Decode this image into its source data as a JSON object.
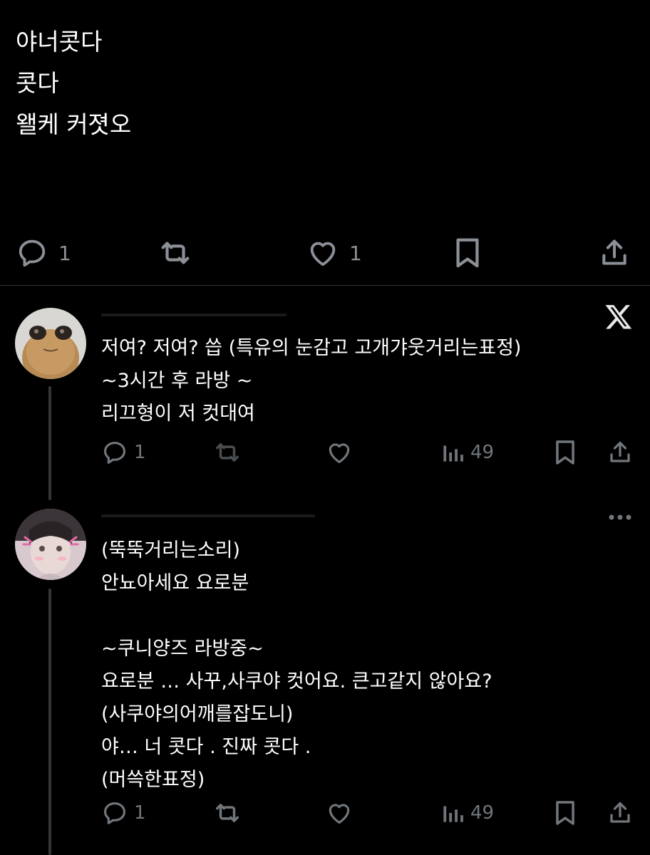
{
  "top_tweet": {
    "lines": [
      "야너콧다",
      "콧다",
      "왤케 커졋오"
    ],
    "reply_count": "1",
    "like_count": "1"
  },
  "replies": [
    {
      "lines": [
        "저여? 저여?  씁 (특유의 눈감고 고개갸웃거리는표정)",
        "~3시간 후 라방 ~",
        "리끄형이  저 컷대여"
      ],
      "reply_count": "1",
      "views_count": "49"
    },
    {
      "lines": [
        "(뚝뚝거리는소리)",
        "안뇨아세요  요로분",
        "",
        "~쿠니양즈  라방중~",
        "요로분 … 사꾸,사쿠야 컷어요. 큰고같지 않아요?",
        "(사쿠야의어깨를잡도니)",
        "야… 너 콧다 .  진짜 콧다  .",
        "(머쓱한표정)"
      ],
      "reply_count": "1",
      "views_count": "49"
    }
  ],
  "colors": {
    "background": "#000000",
    "text": "#ffffff",
    "icon_gray": "#71767b",
    "divider": "#2f3336"
  },
  "icons": [
    "reply-icon",
    "retweet-icon",
    "like-icon",
    "bookmark-icon",
    "share-icon",
    "views-icon",
    "x-logo-icon",
    "more-icon"
  ]
}
